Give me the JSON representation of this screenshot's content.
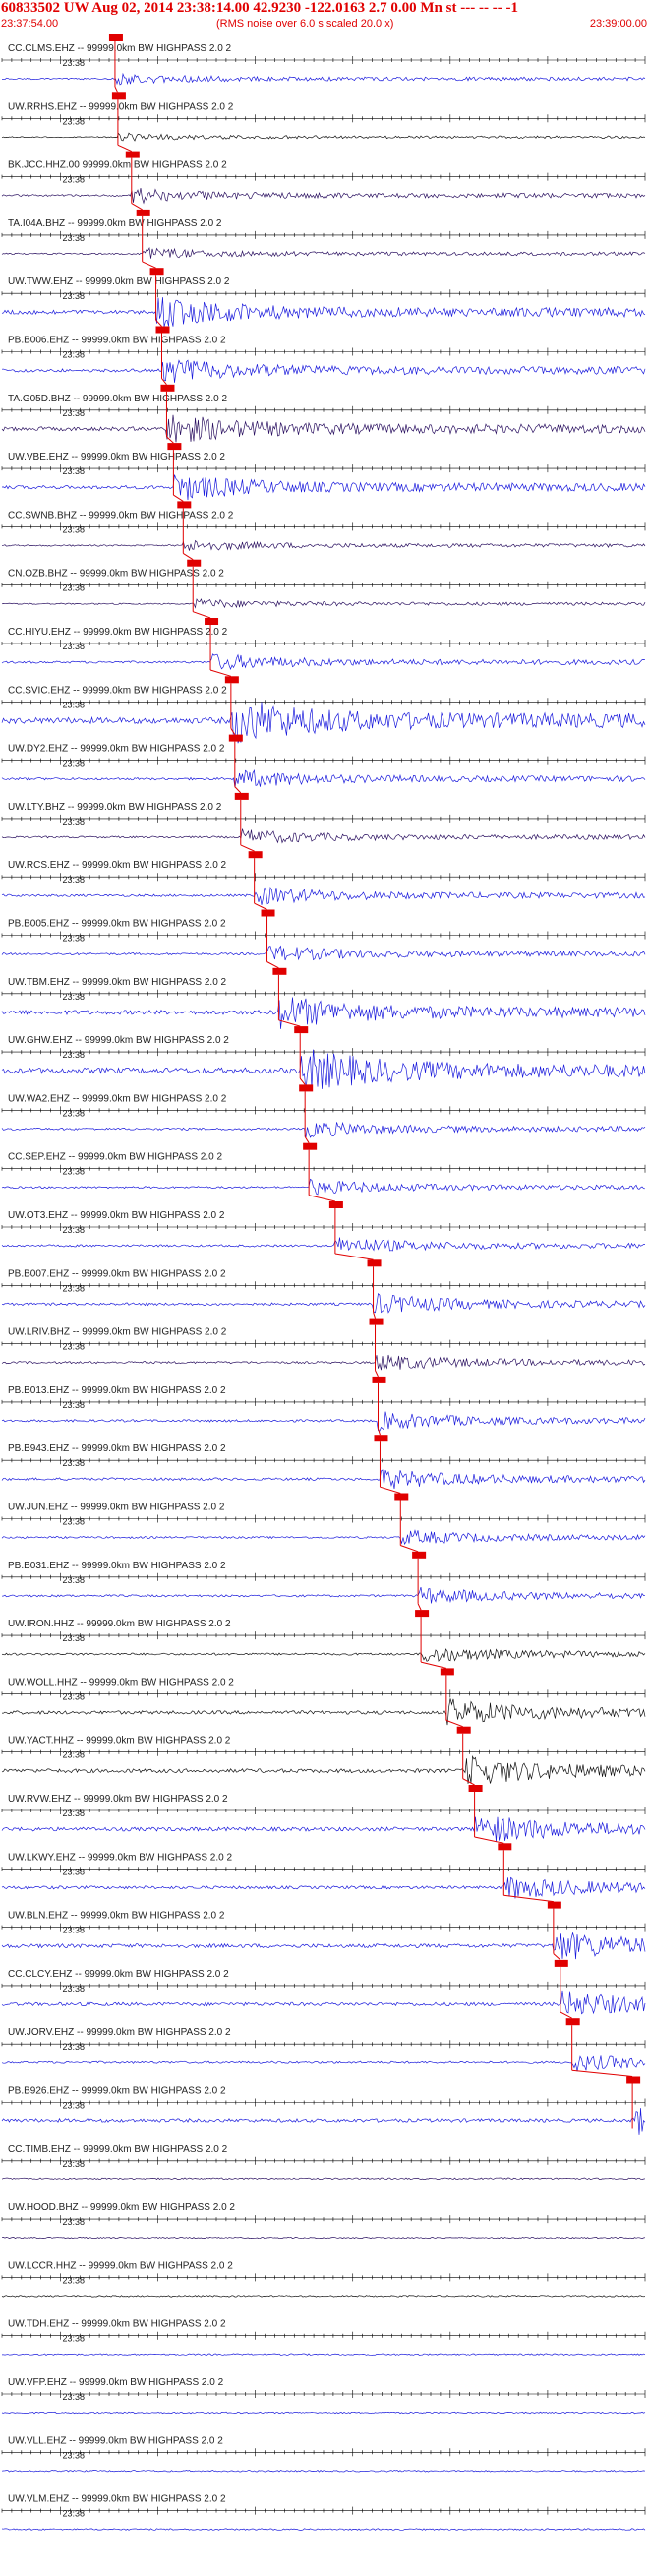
{
  "header": {
    "title": "60833502 UW Aug 02, 2014 23:38:14.00   42.9230 -122.0163  2.7 0.00 Mn st --- -- --  -1",
    "start_time": "23:37:54.00",
    "noise_note": "(RMS noise over 6.0 s scaled 20.0 x)",
    "end_time": "23:39:00.00"
  },
  "time_tick_label": "23:38",
  "colors": {
    "header_text": "#e00000",
    "pick_marker": "#e00000",
    "pick_line": "#e00000",
    "trace_blue": "#1a1adc",
    "trace_purple": "#2a1060",
    "trace_black": "#111111",
    "axis": "#000000",
    "label": "#222222"
  },
  "stations": [
    {
      "label": "CC.CLMS.EHZ -- 99999.0km BW  HIGHPASS  2.0  2",
      "pick_time": "23:38:05.6",
      "trace": "blue",
      "amplitude": 0.35
    },
    {
      "label": "UW.RRHS.EHZ -- 99999.0km BW  HIGHPASS  2.0  2",
      "pick_time": "23:38:05.9",
      "trace": "black",
      "amplitude": 0.25
    },
    {
      "label": "BK.JCC.HHZ.00 99999.0km BW  HIGHPASS  2.0  2",
      "pick_time": "23:38:07.3",
      "trace": "purple",
      "amplitude": 0.45
    },
    {
      "label": "TA.I04A.BHZ -- 99999.0km BW  HIGHPASS  2.0  2",
      "pick_time": "23:38:08.4",
      "trace": "purple",
      "amplitude": 0.35
    },
    {
      "label": "UW.TWW.EHZ -- 99999.0km BW  HIGHPASS  2.0  2",
      "pick_time": "23:38:09.8",
      "trace": "blue",
      "amplitude": 0.9
    },
    {
      "label": "PB.B006.EHZ -- 99999.0km BW  HIGHPASS  2.0  2",
      "pick_time": "23:38:10.4",
      "trace": "blue",
      "amplitude": 0.75
    },
    {
      "label": "TA.G05D.BHZ -- 99999.0km BW  HIGHPASS  2.0  2",
      "pick_time": "23:38:10.9",
      "trace": "purple",
      "amplitude": 0.9
    },
    {
      "label": "UW.VBE.EHZ -- 99999.0km BW  HIGHPASS  2.0  2",
      "pick_time": "23:38:11.6",
      "trace": "blue",
      "amplitude": 0.8
    },
    {
      "label": "CC.SWNB.BHZ -- 99999.0km BW  HIGHPASS  2.0  2",
      "pick_time": "23:38:12.6",
      "trace": "purple",
      "amplitude": 0.35
    },
    {
      "label": "CN.OZB.BHZ -- 99999.0km BW  HIGHPASS  2.0  2",
      "pick_time": "23:38:13.6",
      "trace": "purple",
      "amplitude": 0.3
    },
    {
      "label": "CC.HIYU.EHZ -- 99999.0km BW  HIGHPASS  2.0  2",
      "pick_time": "23:38:15.4",
      "trace": "blue",
      "amplitude": 0.5
    },
    {
      "label": "CC.SVIC.EHZ -- 99999.0km BW  HIGHPASS  2.0  2",
      "pick_time": "23:38:17.5",
      "trace": "blue",
      "amplitude": 1.4
    },
    {
      "label": "UW.DY2.EHZ -- 99999.0km BW  HIGHPASS  2.0  2",
      "pick_time": "23:38:17.9",
      "trace": "blue",
      "amplitude": 0.55
    },
    {
      "label": "UW.LTY.BHZ -- 99999.0km BW  HIGHPASS  2.0  2",
      "pick_time": "23:38:18.5",
      "trace": "purple",
      "amplitude": 0.45
    },
    {
      "label": "UW.RCS.EHZ -- 99999.0km BW  HIGHPASS  2.0  2",
      "pick_time": "23:38:19.9",
      "trace": "blue",
      "amplitude": 0.55
    },
    {
      "label": "PB.B005.EHZ -- 99999.0km BW  HIGHPASS  2.0  2",
      "pick_time": "23:38:21.2",
      "trace": "blue",
      "amplitude": 0.5
    },
    {
      "label": "UW.TBM.EHZ -- 99999.0km BW  HIGHPASS  2.0  2",
      "pick_time": "23:38:22.4",
      "trace": "blue",
      "amplitude": 1.0
    },
    {
      "label": "UW.GHW.EHZ -- 99999.0km BW  HIGHPASS  2.0  2",
      "pick_time": "23:38:24.6",
      "trace": "blue",
      "amplitude": 1.3
    },
    {
      "label": "UW.WA2.EHZ -- 99999.0km BW  HIGHPASS  2.0  2",
      "pick_time": "23:38:25.1",
      "trace": "blue",
      "amplitude": 0.5
    },
    {
      "label": "CC.SEP.EHZ -- 99999.0km BW  HIGHPASS  2.0  2",
      "pick_time": "23:38:25.5",
      "trace": "blue",
      "amplitude": 0.45
    },
    {
      "label": "UW.OT3.EHZ -- 99999.0km BW  HIGHPASS  2.0  2",
      "pick_time": "23:38:28.2",
      "trace": "blue",
      "amplitude": 0.5
    },
    {
      "label": "PB.B007.EHZ -- 99999.0km BW  HIGHPASS  2.0  2",
      "pick_time": "23:38:32.1",
      "trace": "blue",
      "amplitude": 0.6
    },
    {
      "label": "UW.LRIV.BHZ -- 99999.0km BW  HIGHPASS  2.0  2",
      "pick_time": "23:38:32.3",
      "trace": "purple",
      "amplitude": 0.5
    },
    {
      "label": "PB.B013.EHZ -- 99999.0km BW  HIGHPASS  2.0  2",
      "pick_time": "23:38:32.6",
      "trace": "blue",
      "amplitude": 0.55
    },
    {
      "label": "PB.B943.EHZ -- 99999.0km BW  HIGHPASS  2.0  2",
      "pick_time": "23:38:32.8",
      "trace": "blue",
      "amplitude": 0.6
    },
    {
      "label": "UW.JUN.EHZ -- 99999.0km BW  HIGHPASS  2.0  2",
      "pick_time": "23:38:34.9",
      "trace": "blue",
      "amplitude": 0.45
    },
    {
      "label": "PB.B031.EHZ -- 99999.0km BW  HIGHPASS  2.0  2",
      "pick_time": "23:38:36.7",
      "trace": "blue",
      "amplitude": 0.5
    },
    {
      "label": "UW.IRON.HHZ -- 99999.0km BW  HIGHPASS  2.0  2",
      "pick_time": "23:38:37.0",
      "trace": "black",
      "amplitude": 0.5
    },
    {
      "label": "UW.WOLL.HHZ -- 99999.0km BW  HIGHPASS  2.0  2",
      "pick_time": "23:38:39.6",
      "trace": "black",
      "amplitude": 0.8
    },
    {
      "label": "UW.YACT.HHZ -- 99999.0km BW  HIGHPASS  2.0  2",
      "pick_time": "23:38:41.3",
      "trace": "black",
      "amplitude": 0.9
    },
    {
      "label": "UW.RVW.EHZ -- 99999.0km BW  HIGHPASS  2.0  2",
      "pick_time": "23:38:42.5",
      "trace": "blue",
      "amplitude": 0.9
    },
    {
      "label": "UW.LKWY.EHZ -- 99999.0km BW  HIGHPASS  2.0  2",
      "pick_time": "23:38:45.5",
      "trace": "blue",
      "amplitude": 0.7
    },
    {
      "label": "UW.BLN.EHZ -- 99999.0km BW  HIGHPASS  2.0  2",
      "pick_time": "23:38:50.6",
      "trace": "blue",
      "amplitude": 0.9
    },
    {
      "label": "CC.CLCY.EHZ -- 99999.0km BW  HIGHPASS  2.0  2",
      "pick_time": "23:38:51.3",
      "trace": "blue",
      "amplitude": 0.8
    },
    {
      "label": "UW.JORV.EHZ -- 99999.0km BW  HIGHPASS  2.0  2",
      "pick_time": "23:38:52.5",
      "trace": "blue",
      "amplitude": 0.5
    },
    {
      "label": "PB.B926.EHZ -- 99999.0km BW  HIGHPASS  2.0  2",
      "pick_time": "23:38:58.7",
      "trace": "blue",
      "amplitude": 0.8
    },
    {
      "label": "CC.TIMB.EHZ -- 99999.0km BW  HIGHPASS  2.0  2",
      "pick_time": "",
      "trace": "purple",
      "amplitude": 0.35
    },
    {
      "label": "UW.HOOD.BHZ -- 99999.0km BW  HIGHPASS  2.0  2",
      "pick_time": "",
      "trace": "purple",
      "amplitude": 0.3
    },
    {
      "label": "UW.LCCR.HHZ -- 99999.0km BW  HIGHPASS  2.0  2",
      "pick_time": "",
      "trace": "black",
      "amplitude": 0.35
    },
    {
      "label": "UW.TDH.EHZ -- 99999.0km BW  HIGHPASS  2.0  2",
      "pick_time": "",
      "trace": "blue",
      "amplitude": 0.35
    },
    {
      "label": "UW.VFP.EHZ -- 99999.0km BW  HIGHPASS  2.0  2",
      "pick_time": "",
      "trace": "blue",
      "amplitude": 0.35
    },
    {
      "label": "UW.VLL.EHZ -- 99999.0km BW  HIGHPASS  2.0  2",
      "pick_time": "",
      "trace": "blue",
      "amplitude": 0.35
    },
    {
      "label": "UW.VLM.EHZ -- 99999.0km BW  HIGHPASS  2.0  2",
      "pick_time": "",
      "trace": "blue",
      "amplitude": 0.35
    }
  ]
}
